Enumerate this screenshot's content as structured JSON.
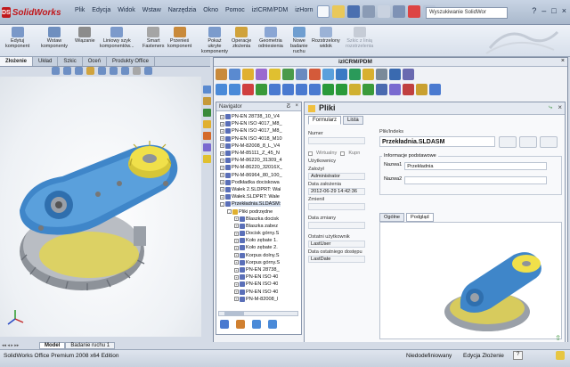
{
  "app": {
    "logo_text": "SolidWorks",
    "logo_mark": "DS"
  },
  "menu": [
    "Plik",
    "Edycja",
    "Widok",
    "Wstaw",
    "Narzędzia",
    "Okno",
    "Pomoc",
    "izICRM/PDM",
    "izHorn"
  ],
  "search": {
    "placeholder": "Wyszukiwanie SolidWor"
  },
  "window_controls": [
    "?",
    "–",
    "□",
    "×"
  ],
  "ribbon": [
    {
      "label1": "Edytuj",
      "label2": "komponent",
      "enabled": true
    },
    {
      "label1": "Wstaw",
      "label2": "komponenty",
      "enabled": true
    },
    {
      "label1": "Wiązanie",
      "label2": "",
      "enabled": true
    },
    {
      "label1": "Liniowy szyk",
      "label2": "komponentów...",
      "enabled": true
    },
    {
      "label1": "Smart",
      "label2": "Fasteners",
      "enabled": true
    },
    {
      "label1": "Przenieś",
      "label2": "komponent",
      "enabled": true
    },
    {
      "label1": "Pokaż",
      "label2": "ukryte",
      "label3": "komponenty",
      "enabled": true
    },
    {
      "label1": "Operacje",
      "label2": "złożenia",
      "enabled": true
    },
    {
      "label1": "Geometria",
      "label2": "odniesienia",
      "enabled": true
    },
    {
      "label1": "Nowe",
      "label2": "badanie",
      "label3": "ruchu",
      "enabled": true
    },
    {
      "label1": "Rozstrzelony",
      "label2": "widok",
      "enabled": true
    },
    {
      "label1": "Szkic z linią",
      "label2": "rozstrzelenia",
      "enabled": false
    }
  ],
  "left_tabs": [
    "Złożenie",
    "Układ",
    "Szkic",
    "Oceń",
    "Produkty Office"
  ],
  "pdm": {
    "title": "izICRM/PDM",
    "navigator": {
      "title": "Navigator",
      "tree": [
        {
          "label": "PN-EN 28738_10_V4",
          "depth": 0,
          "exp": "+"
        },
        {
          "label": "PN-EN ISO 4017_M8_",
          "depth": 0,
          "exp": "+"
        },
        {
          "label": "PN-EN ISO 4017_M8_",
          "depth": 0,
          "exp": "+"
        },
        {
          "label": "PN-EN ISO 4018_M10",
          "depth": 0,
          "exp": "+"
        },
        {
          "label": "PN-M-82008_8_L_V4",
          "depth": 0,
          "exp": "+"
        },
        {
          "label": "PN-M-85111_Z_45_N",
          "depth": 0,
          "exp": "+"
        },
        {
          "label": "PN-M-86220_31309_4",
          "depth": 0,
          "exp": "+"
        },
        {
          "label": "PN-M-86220_32016X_",
          "depth": 0,
          "exp": "+"
        },
        {
          "label": "PN-M-86964_80_100_",
          "depth": 0,
          "exp": "+"
        },
        {
          "label": "Podkładka dociskowa",
          "depth": 0,
          "exp": "+"
        },
        {
          "label": "Wałek 2.SLDPRT: Wał",
          "depth": 0,
          "exp": "+"
        },
        {
          "label": "Wałek.SLDPRT: Wałe",
          "depth": 0,
          "exp": "+"
        },
        {
          "label": "Przekładnia.SLDASM:",
          "depth": 0,
          "exp": "-",
          "selected": true
        },
        {
          "label": "Pliki podrzędne",
          "depth": 1,
          "exp": "-"
        },
        {
          "label": "Blaszka docisk",
          "depth": 2,
          "exp": "+"
        },
        {
          "label": "Blaszka zabez",
          "depth": 2,
          "exp": "+"
        },
        {
          "label": "Docisk górny.S",
          "depth": 2,
          "exp": "+"
        },
        {
          "label": "Koło zębate 1.",
          "depth": 2,
          "exp": "+"
        },
        {
          "label": "Koło zębate 2.",
          "depth": 2,
          "exp": "+"
        },
        {
          "label": "Korpus dolny.S",
          "depth": 2,
          "exp": "+"
        },
        {
          "label": "Korpus górny.S",
          "depth": 2,
          "exp": "+"
        },
        {
          "label": "PN-EN 28738_",
          "depth": 2,
          "exp": "+"
        },
        {
          "label": "PN-EN ISO 40",
          "depth": 2,
          "exp": "+"
        },
        {
          "label": "PN-EN ISO 40",
          "depth": 2,
          "exp": "+"
        },
        {
          "label": "PN-EN ISO 40",
          "depth": 2,
          "exp": "+"
        },
        {
          "label": "PN-M-82008_I",
          "depth": 2,
          "exp": "+"
        }
      ]
    },
    "pliki": {
      "title": "Pliki",
      "tabs": [
        "Formularz",
        "Lista"
      ],
      "numer_label": "Numer",
      "numer_value": "",
      "wirtualny_label": "Wirtualny",
      "kupny_label": "Kupn",
      "uzytkownicy_label": "Użytkownicy",
      "zalozyl_label": "Założył",
      "zalozyl_value": "Administrator",
      "data_zalozenia_label": "Data założenia",
      "data_zalozenia_value": "2012-06-29 14:42:36",
      "zmienil_label": "Zmienił",
      "zmienil_value": "",
      "data_zmiany_label": "Data zmiany",
      "data_zmiany_value": "",
      "ostatni_label": "Ostatni użytkownik",
      "ostatni_value": "LastUser",
      "data_ostatniego_label": "Data ostatniego dostępu",
      "data_ostatniego_value": "LastDate",
      "plik_indeks_label": "Plik/Indeks",
      "plik_value": "Przekładnia.SLDASM",
      "info_group_label": "Informacje podstawowe",
      "nazwa1_label": "Nazwa1",
      "nazwa1_value": "Przekładnia",
      "nazwa2_label": "Nazwa2",
      "nazwa2_value": "",
      "subtabs": [
        "Ogólne",
        "Podgląd"
      ]
    }
  },
  "bottom_tabs": [
    "Model",
    "Badanie ruchu 1"
  ],
  "status": {
    "edition": "SolidWorks Office Premium 2008 x64 Edition",
    "state1": "Niedodefiniowany",
    "state2": "Edycja Złożenie",
    "help": "?"
  },
  "colors": {
    "accent": "#c0181c",
    "gear_blue": "#3a86c8",
    "gear_yellow": "#e8d63a",
    "gear_grey": "#8e939a"
  }
}
